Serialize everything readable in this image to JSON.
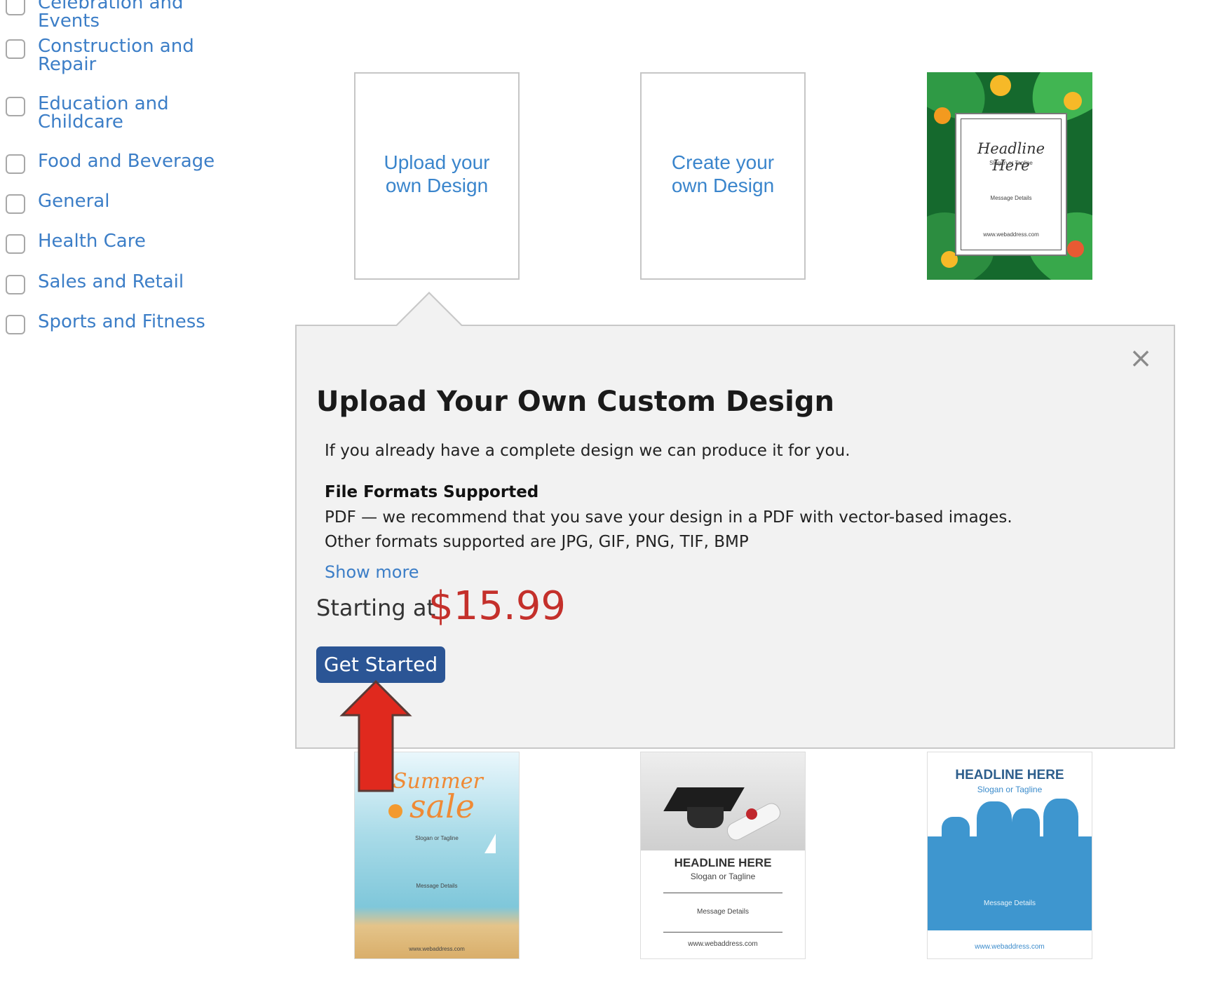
{
  "sidebar": {
    "categories": [
      "Celebration and Events",
      "Construction and\nRepair",
      "Education and\nChildcare",
      "Food and Beverage",
      "General",
      "Health Care",
      "Sales and Retail",
      "Sports and Fitness"
    ]
  },
  "tiles": {
    "upload": "Upload your\nown Design",
    "create": "Create your\nown Design",
    "tropical": {
      "headline": "Headline Here",
      "tagline": "Slogan or Tagline",
      "message": "Message Details",
      "url": "www.webaddress.com"
    },
    "summer": {
      "line1": "Summer",
      "line2": "sale",
      "tagline": "Slogan or Tagline",
      "message": "Message Details",
      "url": "www.webaddress.com"
    },
    "graduation": {
      "headline": "HEADLINE HERE",
      "tagline": "Slogan or Tagline",
      "message": "Message Details",
      "url": "www.webaddress.com"
    },
    "blue": {
      "headline": "HEADLINE HERE",
      "tagline": "Slogan or Tagline",
      "message": "Message Details",
      "url": "www.webaddress.com"
    }
  },
  "popover": {
    "title": "Upload Your Own Custom Design",
    "intro": "If you already have a complete design we can produce it for you.",
    "formats_heading": "File Formats Supported",
    "formats_line1": "PDF — we recommend that you save your design in a PDF with vector-based images.",
    "formats_line2": "Other formats supported are JPG, GIF, PNG, TIF, BMP",
    "show_more": "Show more",
    "starting_at": "Starting at",
    "price": "$15.99",
    "cta": "Get Started",
    "close_glyph": "×"
  },
  "colors": {
    "link_blue": "#3c7ec7",
    "price_red": "#c4302b",
    "button_blue": "#2b5595",
    "arrow_red": "#e0291e"
  }
}
